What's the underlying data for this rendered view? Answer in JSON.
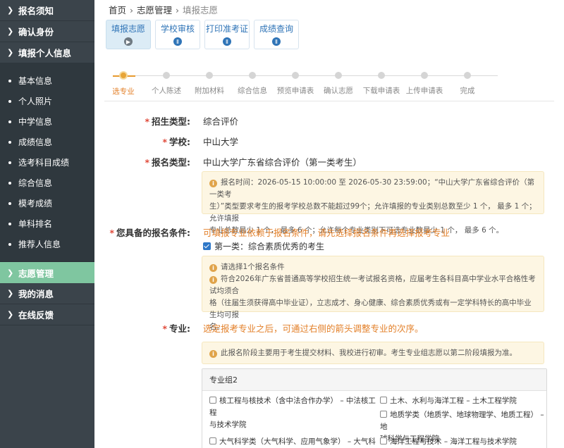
{
  "sidebar": {
    "top_items": [
      {
        "label": "报名须知"
      },
      {
        "label": "确认身份"
      },
      {
        "label": "填报个人信息"
      }
    ],
    "sub_items": [
      {
        "label": "基本信息"
      },
      {
        "label": "个人照片"
      },
      {
        "label": "中学信息"
      },
      {
        "label": "成绩信息"
      },
      {
        "label": "选考科目成绩"
      },
      {
        "label": "综合信息"
      },
      {
        "label": "模考成绩"
      },
      {
        "label": "单科排名"
      },
      {
        "label": "推荐人信息"
      }
    ],
    "bottom_items": [
      {
        "label": "志愿管理",
        "active": true
      },
      {
        "label": "我的消息"
      },
      {
        "label": "在线反馈"
      }
    ]
  },
  "breadcrumb": {
    "home": "首页",
    "section": "志愿管理",
    "current": "填报志愿"
  },
  "tabs": [
    {
      "label": "填报志愿",
      "icon": "play-circle-icon",
      "active": true
    },
    {
      "label": "学校审核",
      "icon": "stamp-icon"
    },
    {
      "label": "打印准考证",
      "icon": "stamp-icon"
    },
    {
      "label": "成绩查询",
      "icon": "stamp-icon"
    }
  ],
  "steps": {
    "current_index": 0,
    "items": [
      {
        "label": "选专业"
      },
      {
        "label": "个人陈述"
      },
      {
        "label": "附加材料"
      },
      {
        "label": "综合信息"
      },
      {
        "label": "预览申请表"
      },
      {
        "label": "确认志愿"
      },
      {
        "label": "下载申请表"
      },
      {
        "label": "上传申请表"
      },
      {
        "label": "完成"
      }
    ]
  },
  "form": {
    "admission_type": {
      "label": "招生类型:",
      "value": "综合评价"
    },
    "school": {
      "label": "学校:",
      "value": "中山大学"
    },
    "apply_type": {
      "label": "报名类型:",
      "value": "中山大学广东省综合评价（第一类考生）"
    },
    "apply_notice": {
      "lines": [
        "报名时间：2026-05-15 10:00:00 至 2026-05-30 23:59:00；“中山大学广东省综合评价（第一类考",
        "生）”类型要求考生的报考学校总数不能超过99个；允许填报的专业类别总数至少 1 个，  最多 1 个；允许填报",
        "专业总数最少 1 个，  最多 6 个；允许每个专业类别下可选专业数最少 1 个，  最多 6 个。"
      ]
    },
    "conditions": {
      "label": "您具备的报名条件:",
      "hint": "可填报专业依赖于报名条件，请先选择报名条件再选择报考专业",
      "option": "第一类：综合素质优秀的考生",
      "notice_title": "请选择1个报名条件",
      "notice_lines": [
        "符合2026年广东省普通高等学校招生统一考试报名资格，应届考生各科目高中学业水平合格性考试均须合",
        "格（往届生须获得高中毕业证），立志成才、身心健康、综合素质优秀或有一定学科特长的高中毕业生均可报",
        "名。"
      ]
    },
    "major": {
      "label": "专业:",
      "hint": "选定报考专业之后，可通过右侧的箭头调整专业的次序。",
      "notice": "此报名阶段主要用于考生提交材料、我校进行初审。考生专业组志愿以第二阶段填报为准。",
      "group_title": "专业组2",
      "majors_left": [
        {
          "line1": "核工程与核技术（含中法合作办学） – 中法核工程",
          "line2": "与技术学院"
        },
        {
          "line1": "大气科学类（大气科学、应用气象学） – 大气科学",
          "line2": ""
        }
      ],
      "majors_right": [
        {
          "line1": "土木、水利与海洋工程 – 土木工程学院",
          "line2": ""
        },
        {
          "line1": "地质学类（地质学、地球物理学、地质工程） – 地",
          "line2": "球科学与工程学院"
        },
        {
          "line1": "海洋工程与技术 – 海洋工程与技术学院",
          "line2": ""
        }
      ]
    }
  },
  "colors": {
    "sidebar_bg": "#3b444b",
    "active_nav": "#7fc6a0",
    "accent_orange": "#e3802a",
    "link_blue": "#2f74b7"
  }
}
